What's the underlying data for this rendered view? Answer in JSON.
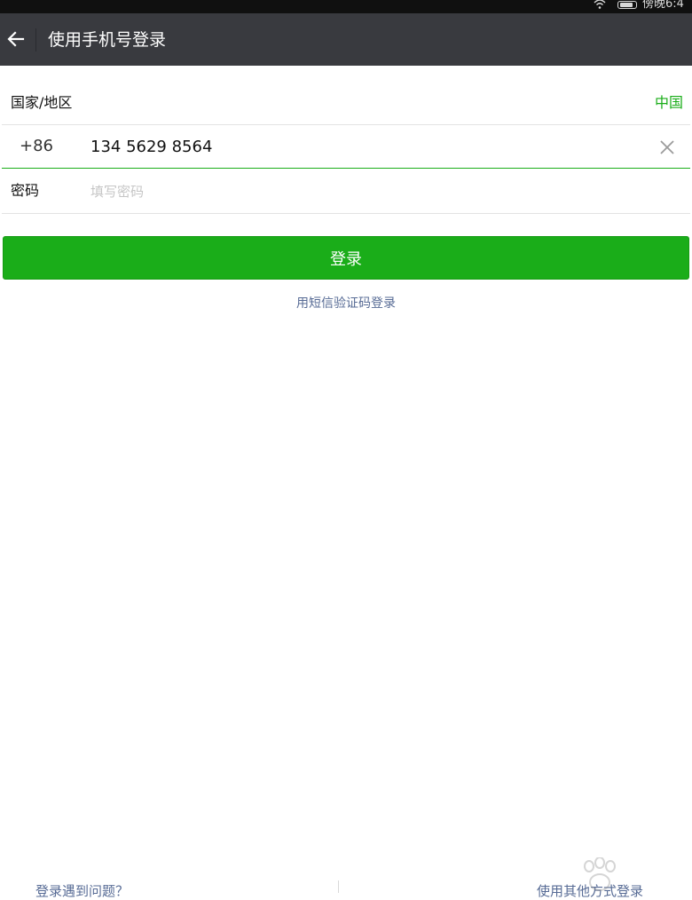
{
  "status_bar": {
    "time": "傍晚6:4"
  },
  "app_bar": {
    "title": "使用手机号登录",
    "back_icon": "arrow-left-icon"
  },
  "form": {
    "region_label": "国家/地区",
    "region_value": "中国",
    "country_code": "+86",
    "phone_value": "134 5629 8564",
    "clear_icon": "close-icon",
    "password_label": "密码",
    "password_placeholder": "填写密码",
    "password_value": ""
  },
  "actions": {
    "login_label": "登录",
    "sms_login_link": "用短信验证码登录"
  },
  "footer": {
    "left_link": "登录遇到问题？",
    "right_link": "使用其他方式登录"
  },
  "colors": {
    "accent_green": "#1aad19",
    "link_blue": "#576b95",
    "app_bar": "#393a3f"
  }
}
